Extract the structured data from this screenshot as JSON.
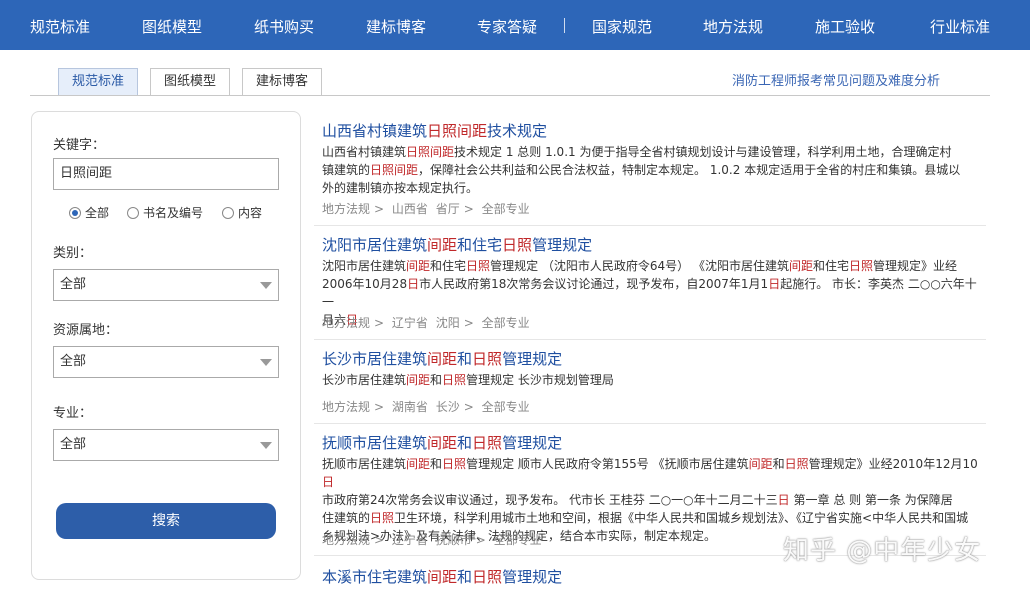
{
  "topnav": {
    "items": [
      "规范标准",
      "图纸模型",
      "纸书购买",
      "建标博客",
      "专家答疑",
      "国家规范",
      "地方法规",
      "施工验收",
      "行业标准"
    ]
  },
  "tabs": [
    "规范标准",
    "图纸模型",
    "建标博客"
  ],
  "top_link": "消防工程师报考常见问题及难度分析",
  "sidebar": {
    "keyword_label": "关键字：",
    "keyword_value": "日照间距",
    "radios": [
      "全部",
      "书名及编号",
      "内容"
    ],
    "category_label": "类别：",
    "category_value": "全部",
    "resource_label": "资源属地：",
    "resource_value": "全部",
    "major_label": "专业：",
    "major_value": "全部",
    "search_button": "搜索"
  },
  "results": [
    {
      "title": "山西省村镇建筑日照间距技术规定",
      "desc_lines": [
        "山西省村镇建筑日照间距技术规定 1 总则 1.0.1 为便于指导全省村镇规划设计与建设管理，科学利用土地，合理确定村",
        "镇建筑的日照间距，保障社会公共利益和公民合法权益，特制定本规定。 1.0.2 本规定适用于全省的村庄和集镇。县城以",
        "外的建制镇亦按本规定执行。"
      ],
      "meta": [
        "地方法规",
        "山西省",
        "省厅",
        "全部专业"
      ]
    },
    {
      "title": "沈阳市居住建筑间距和住宅日照管理规定",
      "desc_lines": [
        "沈阳市居住建筑间距和住宅日照管理规定 （沈阳市人民政府令64号） 《沈阳市居住建筑间距和住宅日照管理规定》业经",
        "2006年10月28日市人民政府第18次常务会议讨论通过，现予发布，自2007年1月1日起施行。 市长：李英杰 二○○六年十一",
        "月六日"
      ],
      "meta": [
        "地方法规",
        "辽宁省",
        "沈阳",
        "全部专业"
      ]
    },
    {
      "title": "长沙市居住建筑间距和日照管理规定",
      "desc_lines": [
        "长沙市居住建筑间距和日照管理规定 长沙市规划管理局"
      ],
      "meta": [
        "地方法规",
        "湖南省",
        "长沙",
        "全部专业"
      ]
    },
    {
      "title": "抚顺市居住建筑间距和日照管理规定",
      "desc_lines": [
        "抚顺市居住建筑间距和日照管理规定 顺市人民政府令第155号 《抚顺市居住建筑间距和日照管理规定》业经2010年12月10日",
        "市政府第24次常务会议审议通过，现予发布。 代市长 王桂芬 二○一○年十二月二十三日 第一章 总 则 第一条 为保障居",
        "住建筑的日照卫生环境，科学利用城市土地和空间，根据《中华人民共和国城乡规划法》、《辽宁省实施<中华人民共和国城",
        "乡规划法>办法》及有关法律、法规的规定，结合本市实际，制定本规定。"
      ],
      "meta": [
        "地方法规",
        "辽宁省",
        "抚顺市",
        "全部专业"
      ]
    },
    {
      "title": "本溪市住宅建筑间距和日照管理规定",
      "desc_lines": [],
      "meta": []
    }
  ],
  "watermark": "知乎 @中年少女",
  "colors": {
    "nav_bg": "#2d66b8",
    "highlight": "#c0282a",
    "title_blue": "#1f4fa0",
    "button_bg": "#2d5ea9"
  }
}
